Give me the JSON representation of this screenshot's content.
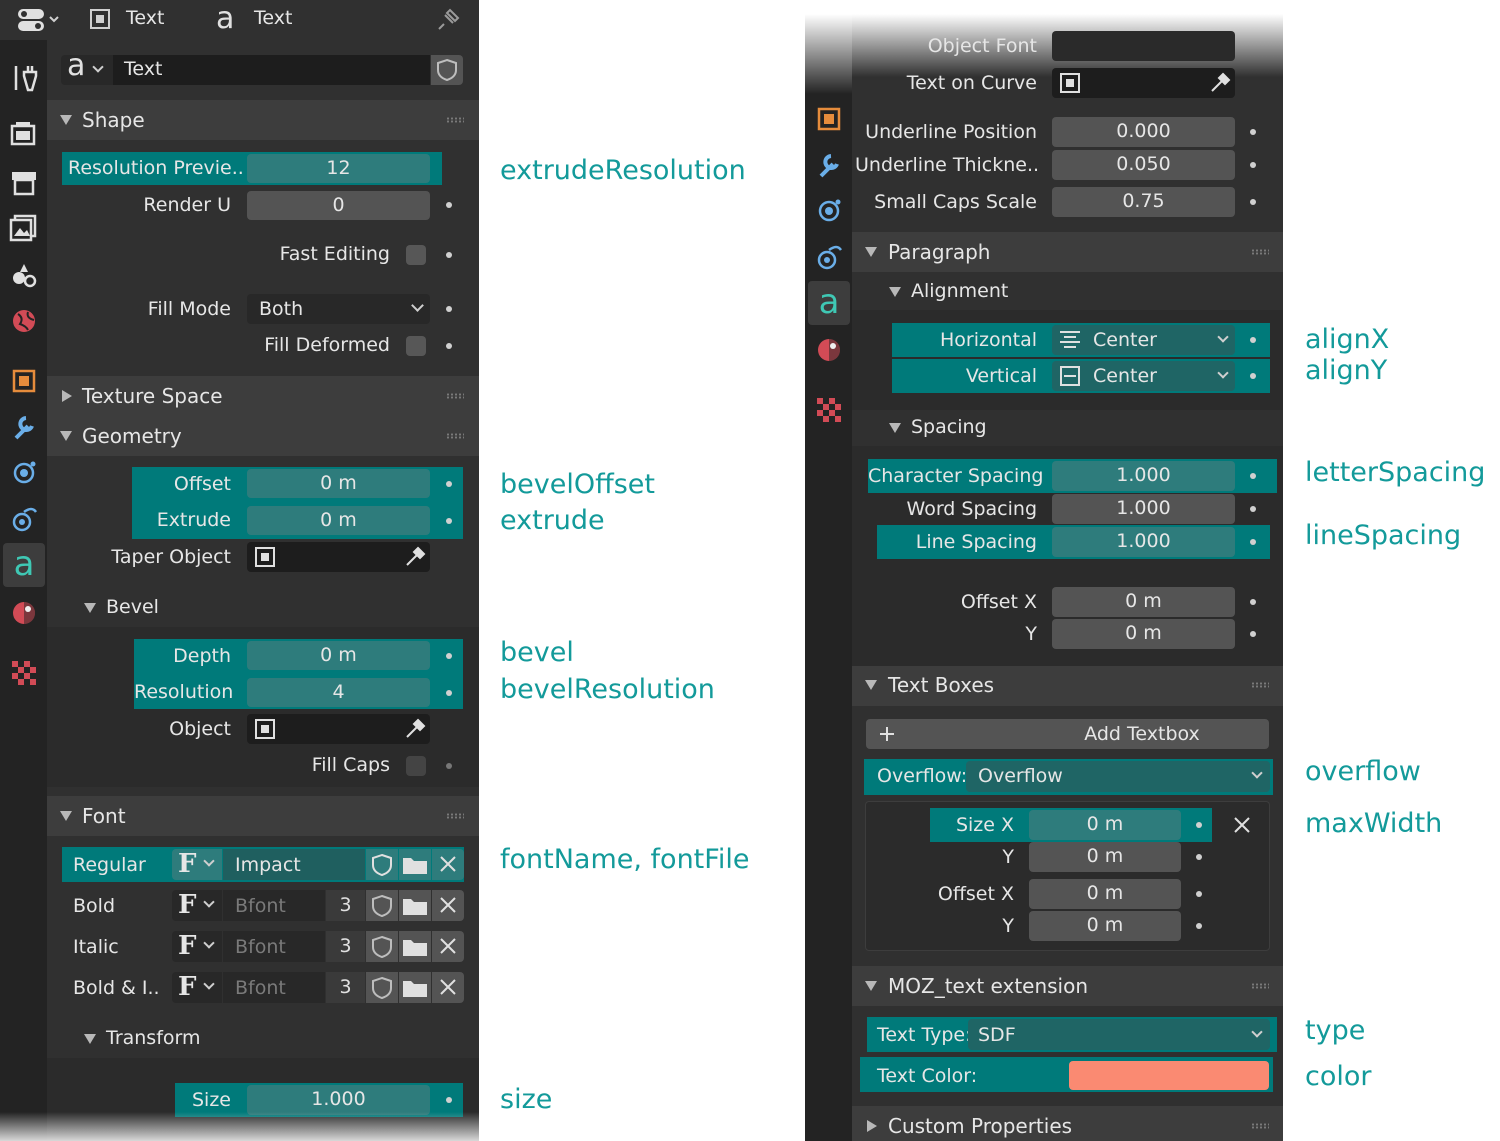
{
  "header": {
    "editor_icon": "editor-type-icon",
    "object_name": "Text",
    "data_name": "Text",
    "pin_icon": "pin-icon"
  },
  "datablock": {
    "name": "Text",
    "fake_user_icon": "shield-icon"
  },
  "left": {
    "shape": {
      "title": "Shape",
      "resolution_preview_label": "Resolution Previe..",
      "resolution_preview_value": "12",
      "render_u_label": "Render U",
      "render_u_value": "0",
      "fast_editing_label": "Fast Editing",
      "fill_mode_label": "Fill Mode",
      "fill_mode_value": "Both",
      "fill_deformed_label": "Fill Deformed"
    },
    "texture_space": {
      "title": "Texture Space"
    },
    "geometry": {
      "title": "Geometry",
      "offset_label": "Offset",
      "offset_value": "0 m",
      "extrude_label": "Extrude",
      "extrude_value": "0 m",
      "taper_label": "Taper Object"
    },
    "bevel": {
      "title": "Bevel",
      "depth_label": "Depth",
      "depth_value": "0 m",
      "resolution_label": "Resolution",
      "resolution_value": "4",
      "object_label": "Object",
      "fill_caps_label": "Fill Caps"
    },
    "font": {
      "title": "Font",
      "rows": [
        {
          "label": "Regular",
          "font": "Impact",
          "users": ""
        },
        {
          "label": "Bold",
          "font": "Bfont",
          "users": "3"
        },
        {
          "label": "Italic",
          "font": "Bfont",
          "users": "3"
        },
        {
          "label": "Bold & I..",
          "font": "Bfont",
          "users": "3"
        }
      ]
    },
    "transform": {
      "title": "Transform",
      "size_label": "Size",
      "size_value": "1.000"
    }
  },
  "right": {
    "object_font_label": "Object Font",
    "text_on_curve_label": "Text on Curve",
    "underline_position_label": "Underline Position",
    "underline_position_value": "0.000",
    "underline_thickness_label": "Underline Thickne..",
    "underline_thickness_value": "0.050",
    "small_caps_label": "Small Caps Scale",
    "small_caps_value": "0.75",
    "paragraph": {
      "title": "Paragraph"
    },
    "alignment": {
      "title": "Alignment",
      "horizontal_label": "Horizontal",
      "horizontal_value": "Center",
      "vertical_label": "Vertical",
      "vertical_value": "Center"
    },
    "spacing": {
      "title": "Spacing",
      "char_label": "Character Spacing",
      "char_value": "1.000",
      "word_label": "Word Spacing",
      "word_value": "1.000",
      "line_label": "Line Spacing",
      "line_value": "1.000",
      "offx_label": "Offset X",
      "offx_value": "0 m",
      "offy_label": "Y",
      "offy_value": "0 m"
    },
    "text_boxes": {
      "title": "Text Boxes",
      "add_label": "Add Textbox",
      "overflow_label": "Overflow:",
      "overflow_value": "Overflow",
      "sizex_label": "Size X",
      "sizex_value": "0 m",
      "sizey_label": "Y",
      "sizey_value": "0 m",
      "offx_label": "Offset X",
      "offx_value": "0 m",
      "offy_label": "Y",
      "offy_value": "0 m"
    },
    "moz": {
      "title": "MOZ_text extension",
      "type_label": "Text Type:",
      "type_value": "SDF",
      "color_label": "Text Color:",
      "color_value": "#fa8a72"
    },
    "custom": {
      "title": "Custom Properties"
    }
  },
  "annotations": {
    "extrude_resolution": "extrudeResolution",
    "bevel_offset": "bevelOffset",
    "extrude": "extrude",
    "bevel": "bevel",
    "bevel_resolution": "bevelResolution",
    "font": "fontName, fontFile",
    "size": "size",
    "align_x": "alignX",
    "align_y": "alignY",
    "letter_spacing": "letterSpacing",
    "line_spacing": "lineSpacing",
    "overflow": "overflow",
    "max_width": "maxWidth",
    "type": "type",
    "color": "color"
  },
  "colors": {
    "accent": "#139a9a",
    "highlight": "#007a7a",
    "panel": "#303030"
  }
}
